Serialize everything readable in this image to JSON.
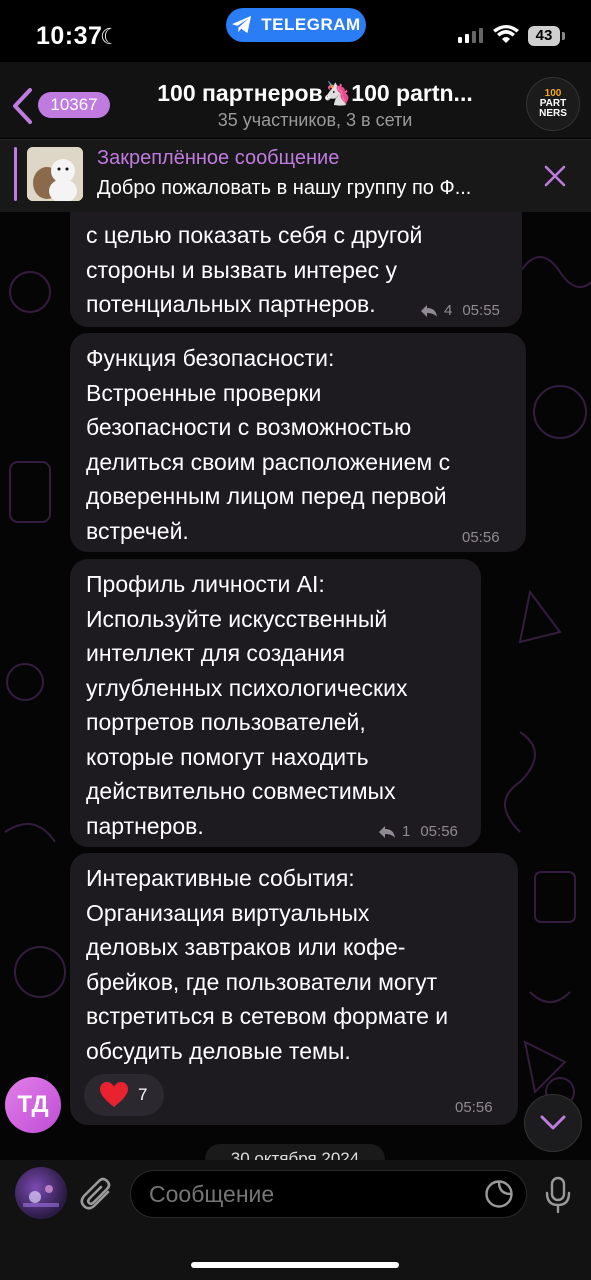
{
  "status_bar": {
    "time": "10:37",
    "app_pill": "TELEGRAM",
    "battery": "43"
  },
  "header": {
    "back_count": "10367",
    "title": "100 партнеров🦄100 partn...",
    "subtitle": "35 участников, 3 в сети",
    "avatar_text": [
      "100",
      "PART",
      "NERS"
    ]
  },
  "pinned": {
    "title": "Закреплённое сообщение",
    "text": "Добро пожаловать в нашу группу по Ф..."
  },
  "messages": [
    {
      "text": "с целью показать себя с другой\nстороны и вызвать интерес у\nпотенциальных партнеров.",
      "replies": "4",
      "time": "05:55"
    },
    {
      "text": "Функция безопасности:\nВстроенные проверки\nбезопасности с возможностью\nделиться своим расположением с\nдоверенным лицом перед первой\nвстречей.",
      "time": "05:56"
    },
    {
      "text": "Профиль личности AI:\nИспользуйте искусственный\nинтеллект для создания\nуглубленных психологических\nпортретов пользователей,\nкоторые помогут находить\nдействительно совместимых\nпартнеров.",
      "replies": "1",
      "time": "05:56"
    },
    {
      "text": "Интерактивные события:\nОрганизация виртуальных\nделовых завтраков или кофе-\nбрейков, где пользователи могут\nвстретиться в сетевом формате и\nобсудить деловые темы.",
      "reaction_count": "7",
      "time": "05:56"
    }
  ],
  "sender_avatar": "ТД",
  "date_separator": "30 октября 2024",
  "input": {
    "placeholder": "Сообщение"
  },
  "colors": {
    "accent": "#c07be0",
    "telegram_blue": "#2a7df4",
    "bubble": "#1d1a20",
    "reaction_heart": "#e8232f"
  }
}
